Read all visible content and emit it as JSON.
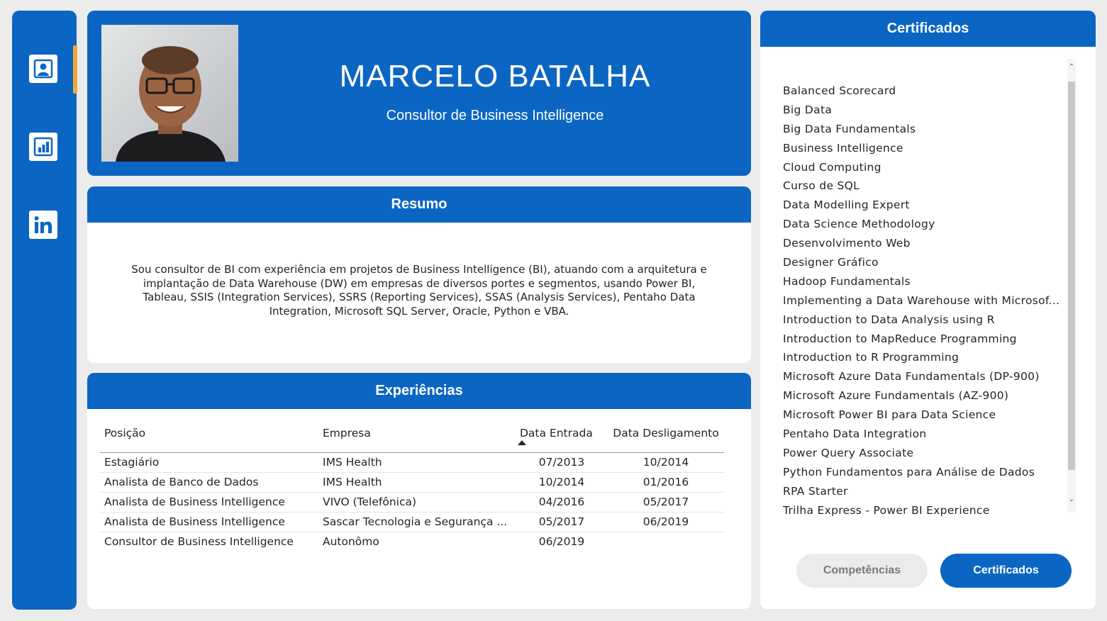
{
  "nav": {
    "icons": [
      "profile-icon",
      "bar-chart-icon",
      "linkedin-icon"
    ]
  },
  "profile": {
    "name": "MARCELO BATALHA",
    "subtitle": "Consultor de Business Intelligence"
  },
  "summary": {
    "title": "Resumo",
    "text": "Sou consultor de BI com experiência em projetos de Business Intelligence (BI), atuando com a arquitetura e implantação de Data Warehouse (DW) em empresas de diversos portes e segmentos, usando Power BI, Tableau, SSIS (Integration Services), SSRS (Reporting Services), SSAS (Analysis Services), Pentaho Data Integration, Microsoft SQL Server, Oracle, Python e VBA."
  },
  "experience": {
    "title": "Experiências",
    "columns": [
      "Posição",
      "Empresa",
      "Data Entrada",
      "Data Desligamento"
    ],
    "rows": [
      [
        "Estagiário",
        "IMS Health",
        "07/2013",
        "10/2014"
      ],
      [
        "Analista de Banco de Dados",
        "IMS Health",
        "10/2014",
        "01/2016"
      ],
      [
        "Analista de Business Intelligence",
        "VIVO (Telefônica)",
        "04/2016",
        "05/2017"
      ],
      [
        "Analista de Business Intelligence",
        "Sascar Tecnologia e Segurança ...",
        "05/2017",
        "06/2019"
      ],
      [
        "Consultor de Business Intelligence",
        "Autonômo",
        "06/2019",
        ""
      ]
    ]
  },
  "certificates": {
    "title": "Certificados",
    "items": [
      "Balanced Scorecard",
      "Big Data",
      "Big Data Fundamentals",
      "Business Intelligence",
      "Cloud Computing",
      "Curso de SQL",
      "Data Modelling Expert",
      "Data Science Methodology",
      "Desenvolvimento Web",
      "Designer Gráfico",
      "Hadoop Fundamentals",
      "Implementing a Data Warehouse with Microsof...",
      "Introduction to Data Analysis using R",
      "Introduction to MapReduce Programming",
      "Introduction to R Programming",
      "Microsoft Azure Data Fundamentals (DP-900)",
      "Microsoft Azure Fundamentals (AZ-900)",
      "Microsoft Power BI para Data Science",
      "Pentaho Data Integration",
      "Power Query Associate",
      "Python Fundamentos para Análise de Dados",
      "RPA Starter",
      "Trilha Express - Power BI Experience"
    ]
  },
  "buttons": {
    "competencias": "Competências",
    "certificados": "Certificados"
  },
  "colors": {
    "brand": "#0b66c3",
    "accent": "#f0a732",
    "background": "#ececec"
  }
}
